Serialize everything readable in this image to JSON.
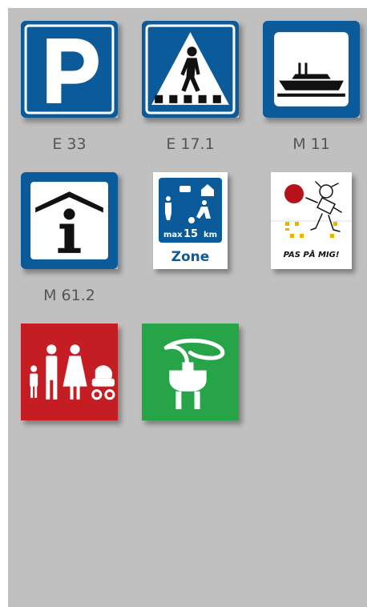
{
  "signs": [
    {
      "caption": "E 33",
      "name": "parking"
    },
    {
      "caption": "E 17.1",
      "name": "pedestrian-crossing"
    },
    {
      "caption": "M 11",
      "name": "ferry"
    },
    {
      "caption": "M 61.2",
      "name": "tourist-information"
    },
    {
      "caption": "",
      "name": "living-street-zone",
      "text_max": "max",
      "text_speed": "15",
      "text_unit": "km",
      "text_zone": "Zone"
    },
    {
      "caption": "",
      "name": "pas-paa-mig",
      "text": "PAS PÅ MIG!"
    },
    {
      "caption": "",
      "name": "family"
    },
    {
      "caption": "",
      "name": "ev-charging"
    }
  ],
  "colors": {
    "panel": "#c0c0c0",
    "blue": "#0b5a9a",
    "red": "#c41e24",
    "green": "#27a348",
    "caption": "#555555"
  }
}
